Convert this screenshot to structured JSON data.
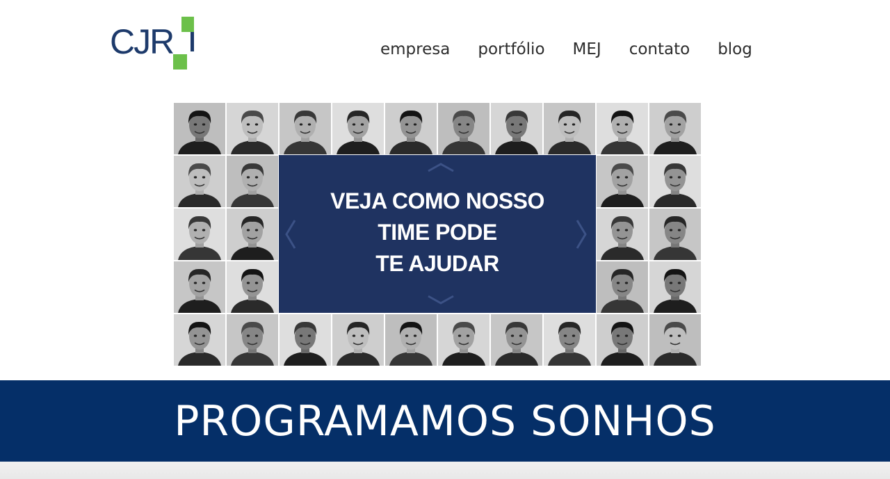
{
  "logo": {
    "text": "CJR"
  },
  "nav": {
    "items": [
      {
        "label": "empresa"
      },
      {
        "label": "portfólio"
      },
      {
        "label": "MEJ"
      },
      {
        "label": "contato"
      },
      {
        "label": "blog"
      }
    ]
  },
  "hero": {
    "line1": "VEJA COMO NOSSO",
    "line2": "TIME PODE",
    "line3": "TE AJUDAR",
    "arrows": [
      "chevron-up-icon",
      "chevron-down-icon",
      "chevron-left-icon",
      "chevron-right-icon"
    ]
  },
  "banner": {
    "text": "PROGRAMAMOS SONHOS"
  },
  "colors": {
    "brand_blue": "#1d3a6b",
    "brand_green": "#6cc04a",
    "panel": "#1f3361",
    "banner": "#052f68"
  }
}
